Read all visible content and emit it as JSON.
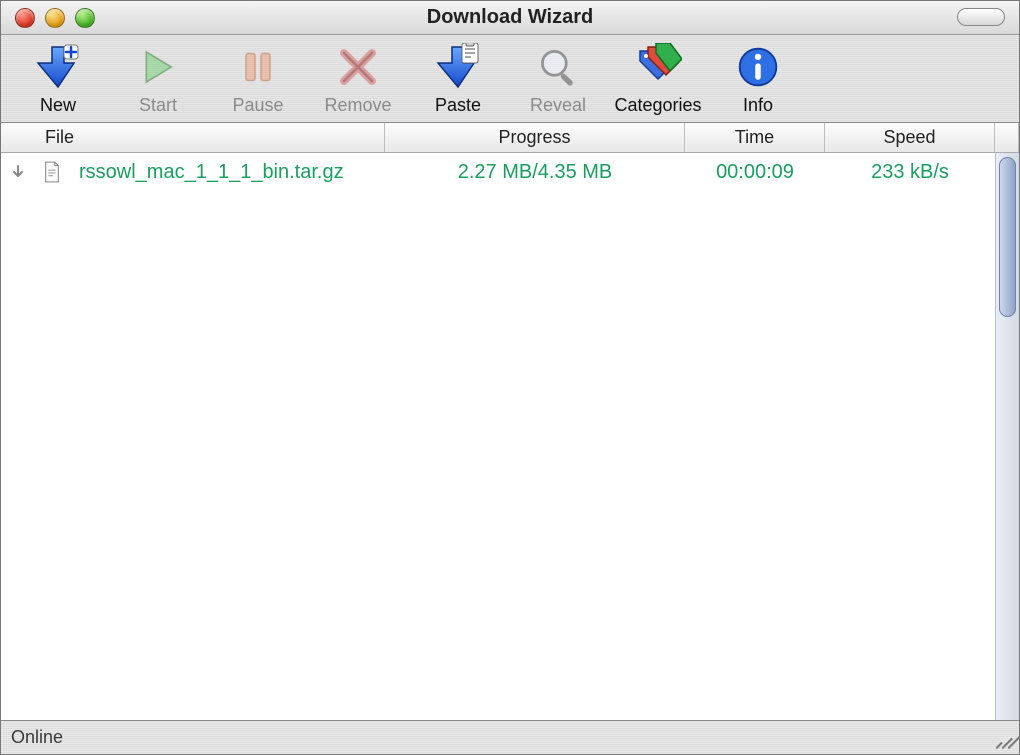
{
  "window": {
    "title": "Download Wizard"
  },
  "toolbar": {
    "new": {
      "label": "New",
      "enabled": true
    },
    "start": {
      "label": "Start",
      "enabled": false
    },
    "pause": {
      "label": "Pause",
      "enabled": false
    },
    "remove": {
      "label": "Remove",
      "enabled": false
    },
    "paste": {
      "label": "Paste",
      "enabled": true
    },
    "reveal": {
      "label": "Reveal",
      "enabled": false
    },
    "categories": {
      "label": "Categories",
      "enabled": true
    },
    "info": {
      "label": "Info",
      "enabled": true
    }
  },
  "columns": {
    "file": "File",
    "progress": "Progress",
    "time": "Time",
    "speed": "Speed"
  },
  "rows": [
    {
      "state_icon": "download-arrow",
      "file_icon": "document",
      "file": "rssowl_mac_1_1_1_bin.tar.gz",
      "progress": "2.27 MB/4.35 MB",
      "time": "00:00:09",
      "speed": "233 kB/s"
    }
  ],
  "status": {
    "text": "Online"
  }
}
